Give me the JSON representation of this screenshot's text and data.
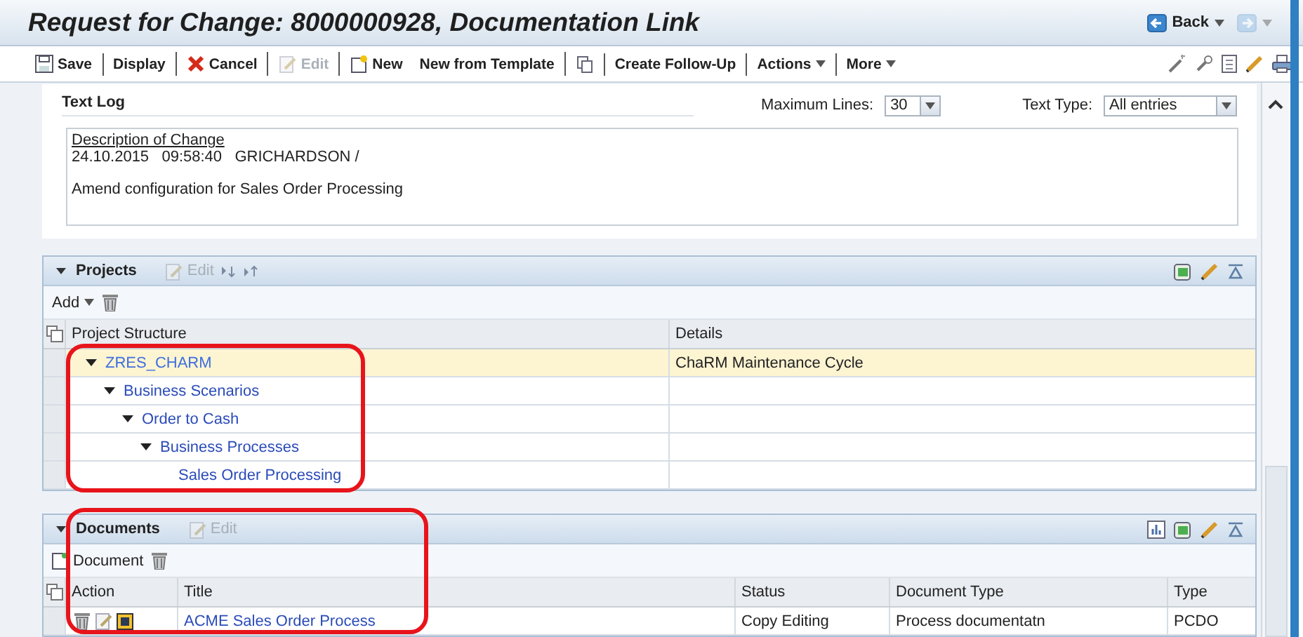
{
  "window": {
    "title": "Request for Change: 8000000928, Documentation Link"
  },
  "navigation": {
    "back": "Back",
    "forward_disabled": true
  },
  "toolbar": [
    {
      "label": "Save",
      "kind": "button",
      "disabled": false,
      "separated": false
    },
    {
      "label": "Display",
      "kind": "button",
      "disabled": false,
      "separated": true
    },
    {
      "label": "Cancel",
      "kind": "button",
      "disabled": false,
      "separated": true
    },
    {
      "label": "Edit",
      "kind": "button",
      "disabled": true,
      "separated": true
    },
    {
      "label": "New",
      "kind": "button",
      "disabled": false,
      "separated": true
    },
    {
      "label": "New from Template",
      "kind": "button",
      "disabled": false,
      "separated": false
    },
    {
      "kind": "icon",
      "disabled": false,
      "separated": true
    },
    {
      "label": "Create Follow-Up",
      "kind": "button",
      "disabled": false,
      "separated": true
    },
    {
      "label": "Actions",
      "kind": "menu",
      "disabled": false,
      "separated": true
    },
    {
      "label": "More",
      "kind": "menu",
      "disabled": false,
      "separated": true
    }
  ],
  "text_log": {
    "title": "Text Log",
    "max_lines_label": "Maximum Lines:",
    "max_lines": "30",
    "text_type_label": "Text Type:",
    "text_type": "All entries",
    "entry": {
      "heading": "Description of Change",
      "meta": "24.10.2015   09:58:40   GRICHARDSON /",
      "body": "Amend configuration for Sales Order Processing"
    }
  },
  "projects": {
    "kind": "tree",
    "title": "Projects",
    "expanded": true,
    "highlight": true,
    "edit": {
      "label": "Edit",
      "disabled": true
    },
    "add": "Add",
    "columns": [
      "Project Structure",
      "Details"
    ],
    "tree": [
      {
        "label": "ZRES_CHARM",
        "details": "ChaRM Maintenance Cycle",
        "selected": true,
        "expanded": true,
        "children": [
          {
            "label": "Business Scenarios",
            "selected": false,
            "expanded": true,
            "children": [
              {
                "label": "Order to Cash",
                "selected": false,
                "expanded": true,
                "children": [
                  {
                    "label": "Business Processes",
                    "selected": false,
                    "expanded": true,
                    "children": [
                      {
                        "label": "Sales Order Processing",
                        "selected": false
                      }
                    ]
                  }
                ]
              }
            ]
          }
        ]
      }
    ]
  },
  "documents": {
    "kind": "table",
    "title": "Documents",
    "expanded": true,
    "highlight": true,
    "edit": {
      "label": "Edit",
      "disabled": true
    },
    "add": "Document",
    "columns": [
      "Action",
      "Title",
      "Status",
      "Document Type",
      "Type"
    ],
    "rows": [
      {
        "title": "ACME Sales Order Process",
        "status": "Copy Editing",
        "document_type": "Process documentatn",
        "type": "PCDO"
      }
    ]
  }
}
